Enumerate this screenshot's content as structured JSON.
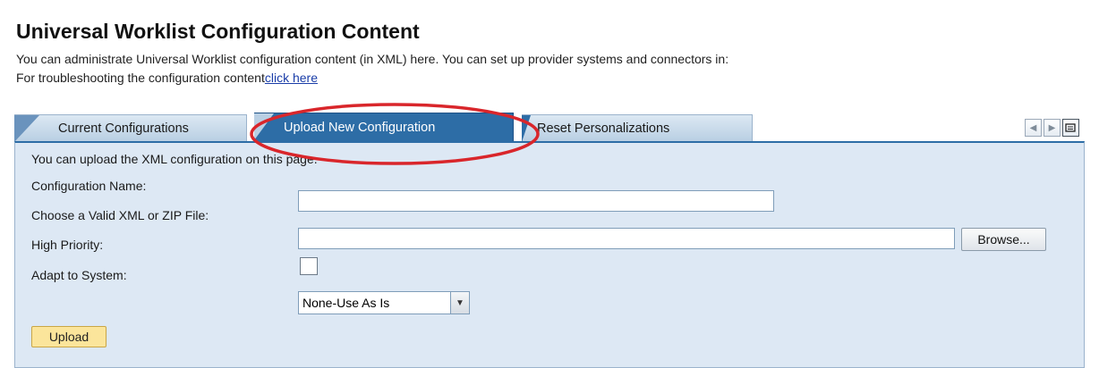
{
  "header": {
    "title": "Universal Worklist Configuration Content",
    "description_line1": "You can administrate Universal Worklist configuration content (in XML) here. You can set up provider systems and connectors in:",
    "description_line2": "For troubleshooting the configuration content",
    "troubleshoot_link": "click here"
  },
  "tabs": [
    {
      "label": "Current Configurations",
      "active": false
    },
    {
      "label": "Upload New Configuration",
      "active": true
    },
    {
      "label": "Reset Personalizations",
      "active": false
    }
  ],
  "nav": {
    "prev_icon": "chevron-left-icon",
    "next_icon": "chevron-right-icon",
    "menu_icon": "tab-list-icon"
  },
  "form": {
    "intro": "You can upload the XML configuration on this page.",
    "config_name_label": "Configuration Name:",
    "config_name_value": "",
    "file_label": "Choose a Valid XML or ZIP File:",
    "file_value": "",
    "browse_label": "Browse...",
    "priority_label": "High Priority:",
    "priority_checked": false,
    "adapt_label": "Adapt to System:",
    "adapt_selected": "None-Use As Is",
    "upload_label": "Upload"
  },
  "colors": {
    "active_tab": "#2d6da6",
    "panel_bg": "#dde8f4",
    "upload_button": "#fbe59b",
    "highlight_ring": "#d9262b"
  }
}
